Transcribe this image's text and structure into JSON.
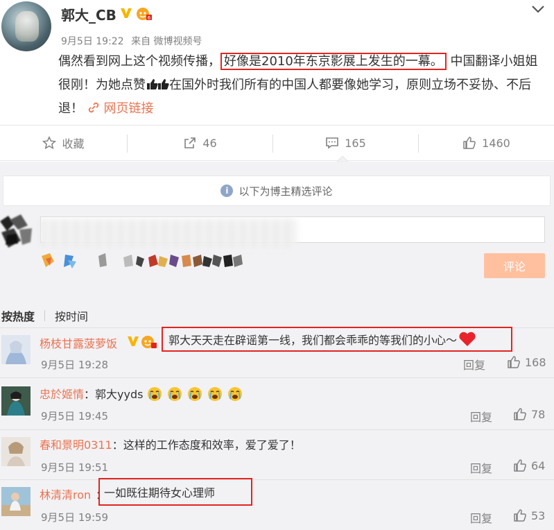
{
  "post": {
    "author": "郭大_CB",
    "date": "9月5日 19:22",
    "source": "来自 微博视频号",
    "text_before": "偶然看到网上这个视频传播，",
    "text_highlight": "好像是2010年东京影展上发生的一幕。",
    "text_mid": "中国翻译小姐姐很刚！为她点赞",
    "text_after": "在国外时我们所有的中国人都要像她学习，原则立场不妥协、不后退！",
    "link_label": "网页链接"
  },
  "actions": {
    "favorite_label": "收藏",
    "repost_count": "46",
    "comment_count": "165",
    "like_count": "1460"
  },
  "comment_area": {
    "notice": "以下为博主精选评论",
    "submit_label": "评论",
    "sort_hot": "按热度",
    "sort_time": "按时间",
    "reply_label": "回复"
  },
  "comments": [
    {
      "name": "杨枝甘露菠萝饭",
      "text": "郭大天天走在辟谣第一线，我们都会乖乖的等我们的小心～",
      "time": "9月5日 19:28",
      "likes": "168"
    },
    {
      "name": "忠於姬情",
      "text": "：郭大yyds",
      "time": "9月5日 19:45",
      "likes": "78"
    },
    {
      "name": "春和景明0311",
      "text": "：这样的工作态度和效率，爱了爱了！",
      "time": "9月5日 19:51",
      "likes": "64"
    },
    {
      "name": "林清清ron",
      "text": "一如既往期待女心理师",
      "time": "9月5日 19:59",
      "likes": "53"
    }
  ],
  "colors": {
    "accent": "#eb7350",
    "highlight_border": "#e5231d",
    "submit_bg": "#ffc09f",
    "comment_bg": "#f2f2f5"
  }
}
